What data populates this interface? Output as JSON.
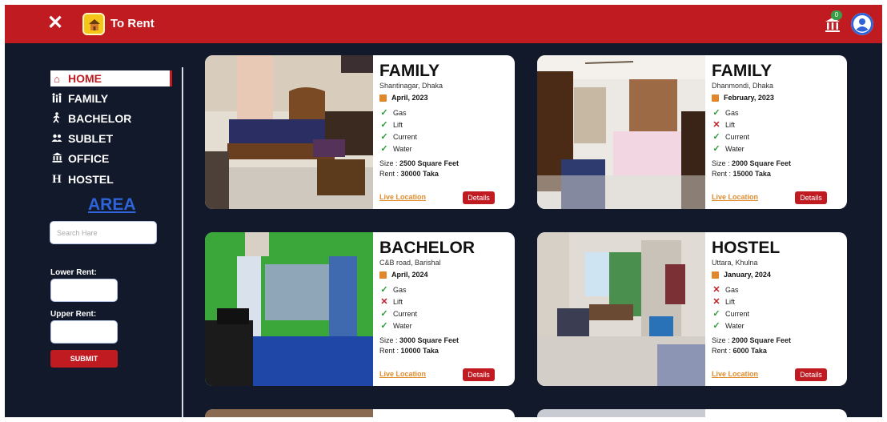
{
  "header": {
    "brand_title": "To Rent",
    "notification_count": "0",
    "accent": "#c11b22"
  },
  "sidebar": {
    "items": [
      {
        "label": "HOME",
        "icon": "home-icon",
        "active": true
      },
      {
        "label": "FAMILY",
        "icon": "family-icon",
        "active": false
      },
      {
        "label": "BACHELOR",
        "icon": "person-walking-icon",
        "active": false
      },
      {
        "label": "SUBLET",
        "icon": "users-icon",
        "active": false
      },
      {
        "label": "OFFICE",
        "icon": "building-columns-icon",
        "active": false
      },
      {
        "label": "HOSTEL",
        "icon": "hostel-icon",
        "active": false
      }
    ],
    "area_title": "AREA",
    "search_placeholder": "Search Hare",
    "lower_rent_label": "Lower Rent:",
    "upper_rent_label": "Upper Rent:",
    "submit_label": "SUBMIT"
  },
  "listings": [
    {
      "type": "FAMILY",
      "location": "Shantinagar, Dhaka",
      "date": "April, 2023",
      "amenities": [
        {
          "name": "Gas",
          "available": true
        },
        {
          "name": "Lift",
          "available": true
        },
        {
          "name": "Current",
          "available": true
        },
        {
          "name": "Water",
          "available": true
        }
      ],
      "size_label": "Size : ",
      "size_value": "2500 Square Feet",
      "rent_label": "Rent : ",
      "rent_value": "30000 Taka",
      "live_location_label": "Live Location",
      "details_label": "Details"
    },
    {
      "type": "FAMILY",
      "location": "Dhanmondi, Dhaka",
      "date": "February, 2023",
      "amenities": [
        {
          "name": "Gas",
          "available": true
        },
        {
          "name": "Lift",
          "available": false
        },
        {
          "name": "Current",
          "available": true
        },
        {
          "name": "Water",
          "available": true
        }
      ],
      "size_label": "Size : ",
      "size_value": "2000 Square Feet",
      "rent_label": "Rent : ",
      "rent_value": "15000 Taka",
      "live_location_label": "Live Location",
      "details_label": "Details"
    },
    {
      "type": "BACHELOR",
      "location": "C&B road, Barishal",
      "date": "April, 2024",
      "amenities": [
        {
          "name": "Gas",
          "available": true
        },
        {
          "name": "Lift",
          "available": false
        },
        {
          "name": "Current",
          "available": true
        },
        {
          "name": "Water",
          "available": true
        }
      ],
      "size_label": "Size : ",
      "size_value": "3000 Square Feet",
      "rent_label": "Rent : ",
      "rent_value": "10000 Taka",
      "live_location_label": "Live Location",
      "details_label": "Details"
    },
    {
      "type": "HOSTEL",
      "location": "Uttara, Khulna",
      "date": "January, 2024",
      "amenities": [
        {
          "name": "Gas",
          "available": false
        },
        {
          "name": "Lift",
          "available": false
        },
        {
          "name": "Current",
          "available": true
        },
        {
          "name": "Water",
          "available": true
        }
      ],
      "size_label": "Size : ",
      "size_value": "2000 Square Feet",
      "rent_label": "Rent : ",
      "rent_value": "6000 Taka",
      "live_location_label": "Live Location",
      "details_label": "Details"
    }
  ]
}
